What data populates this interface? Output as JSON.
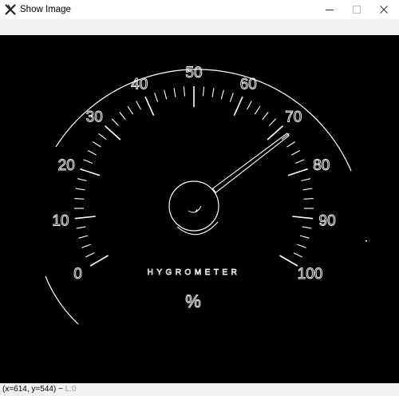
{
  "window": {
    "title": "Show Image",
    "app_icon": "x-logo-icon",
    "controls": [
      "minimize-icon",
      "maximize-icon",
      "close-icon"
    ]
  },
  "gauge": {
    "brand_label": "HYGROMETER",
    "unit_label": "%",
    "scale_labels": [
      "0",
      "10",
      "20",
      "30",
      "40",
      "50",
      "60",
      "70",
      "80",
      "90",
      "100"
    ],
    "needle_value": 72,
    "style": "white edge outlines on black (edge-detected image)"
  },
  "statusbar": {
    "coords": "(x=614, y=544) ~",
    "level": "L:0"
  },
  "colors": {
    "canvas_bg": "#000000",
    "lines": "#ffffff",
    "chrome_bg": "#f0f0f0",
    "titlebar_bg": "#ffffff"
  }
}
